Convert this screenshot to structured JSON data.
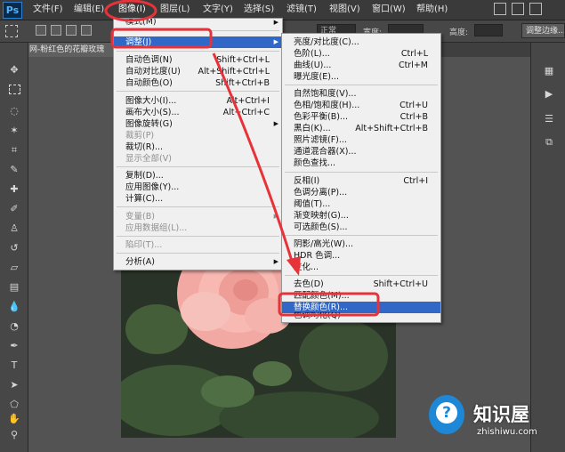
{
  "app": {
    "logo": "Ps"
  },
  "menubar": {
    "items": [
      "文件(F)",
      "编辑(E)",
      "图像(I)",
      "图层(L)",
      "文字(Y)",
      "选择(S)",
      "滤镜(T)",
      "视图(V)",
      "窗口(W)",
      "帮助(H)"
    ]
  },
  "options": {
    "style_label": "正常",
    "width_label": "宽度:",
    "height_label": "高度:",
    "refine_button": "调整边缘..."
  },
  "document": {
    "tab_title": "网-粉红色的花瓣玫瑰"
  },
  "image_menu": {
    "partial_top": "模式(M)",
    "items": [
      {
        "label": "调整(J)",
        "shortcut": "",
        "submenu": true,
        "highlighted": true
      },
      {
        "label": "自动色调(N)",
        "shortcut": "Shift+Ctrl+L"
      },
      {
        "label": "自动对比度(U)",
        "shortcut": "Alt+Shift+Ctrl+L"
      },
      {
        "label": "自动颜色(O)",
        "shortcut": "Shift+Ctrl+B"
      },
      {
        "label": "图像大小(I)...",
        "shortcut": "Alt+Ctrl+I"
      },
      {
        "label": "画布大小(S)...",
        "shortcut": "Alt+Ctrl+C"
      },
      {
        "label": "图像旋转(G)",
        "shortcut": "",
        "submenu": true
      },
      {
        "label": "裁剪(P)",
        "shortcut": "",
        "disabled": true
      },
      {
        "label": "裁切(R)...",
        "shortcut": ""
      },
      {
        "label": "显示全部(V)",
        "shortcut": "",
        "disabled": true
      },
      {
        "label": "复制(D)...",
        "shortcut": ""
      },
      {
        "label": "应用图像(Y)...",
        "shortcut": ""
      },
      {
        "label": "计算(C)...",
        "shortcut": ""
      },
      {
        "label": "变量(B)",
        "shortcut": "",
        "submenu": true,
        "disabled": true
      },
      {
        "label": "应用数据组(L)...",
        "shortcut": "",
        "disabled": true
      },
      {
        "label": "陷印(T)...",
        "shortcut": "",
        "disabled": true
      },
      {
        "label": "分析(A)",
        "shortcut": "",
        "submenu": true
      }
    ]
  },
  "adjust_menu": {
    "items": [
      {
        "label": "亮度/对比度(C)...",
        "shortcut": ""
      },
      {
        "label": "色阶(L)...",
        "shortcut": "Ctrl+L"
      },
      {
        "label": "曲线(U)...",
        "shortcut": "Ctrl+M"
      },
      {
        "label": "曝光度(E)...",
        "shortcut": ""
      },
      {
        "label": "自然饱和度(V)...",
        "shortcut": ""
      },
      {
        "label": "色相/饱和度(H)...",
        "shortcut": "Ctrl+U"
      },
      {
        "label": "色彩平衡(B)...",
        "shortcut": "Ctrl+B"
      },
      {
        "label": "黑白(K)...",
        "shortcut": "Alt+Shift+Ctrl+B"
      },
      {
        "label": "照片滤镜(F)...",
        "shortcut": ""
      },
      {
        "label": "通道混合器(X)...",
        "shortcut": ""
      },
      {
        "label": "颜色查找...",
        "shortcut": ""
      },
      {
        "label": "反相(I)",
        "shortcut": "Ctrl+I"
      },
      {
        "label": "色调分离(P)...",
        "shortcut": ""
      },
      {
        "label": "阈值(T)...",
        "shortcut": ""
      },
      {
        "label": "渐变映射(G)...",
        "shortcut": ""
      },
      {
        "label": "可选颜色(S)...",
        "shortcut": ""
      },
      {
        "label": "阴影/高光(W)...",
        "shortcut": ""
      },
      {
        "label": "HDR 色调...",
        "shortcut": ""
      },
      {
        "label": "变化...",
        "shortcut": ""
      },
      {
        "label": "去色(D)",
        "shortcut": "Shift+Ctrl+U"
      },
      {
        "label": "匹配颜色(M)...",
        "shortcut": ""
      },
      {
        "label": "替换颜色(R)...",
        "shortcut": "",
        "highlighted": true
      },
      {
        "label": "色调均化(Q)",
        "shortcut": ""
      }
    ]
  },
  "watermark": {
    "title": "知识屋",
    "url": "zhishiwu.com"
  },
  "colors": {
    "highlight": "#3168c8",
    "annotation": "#e8323a"
  }
}
